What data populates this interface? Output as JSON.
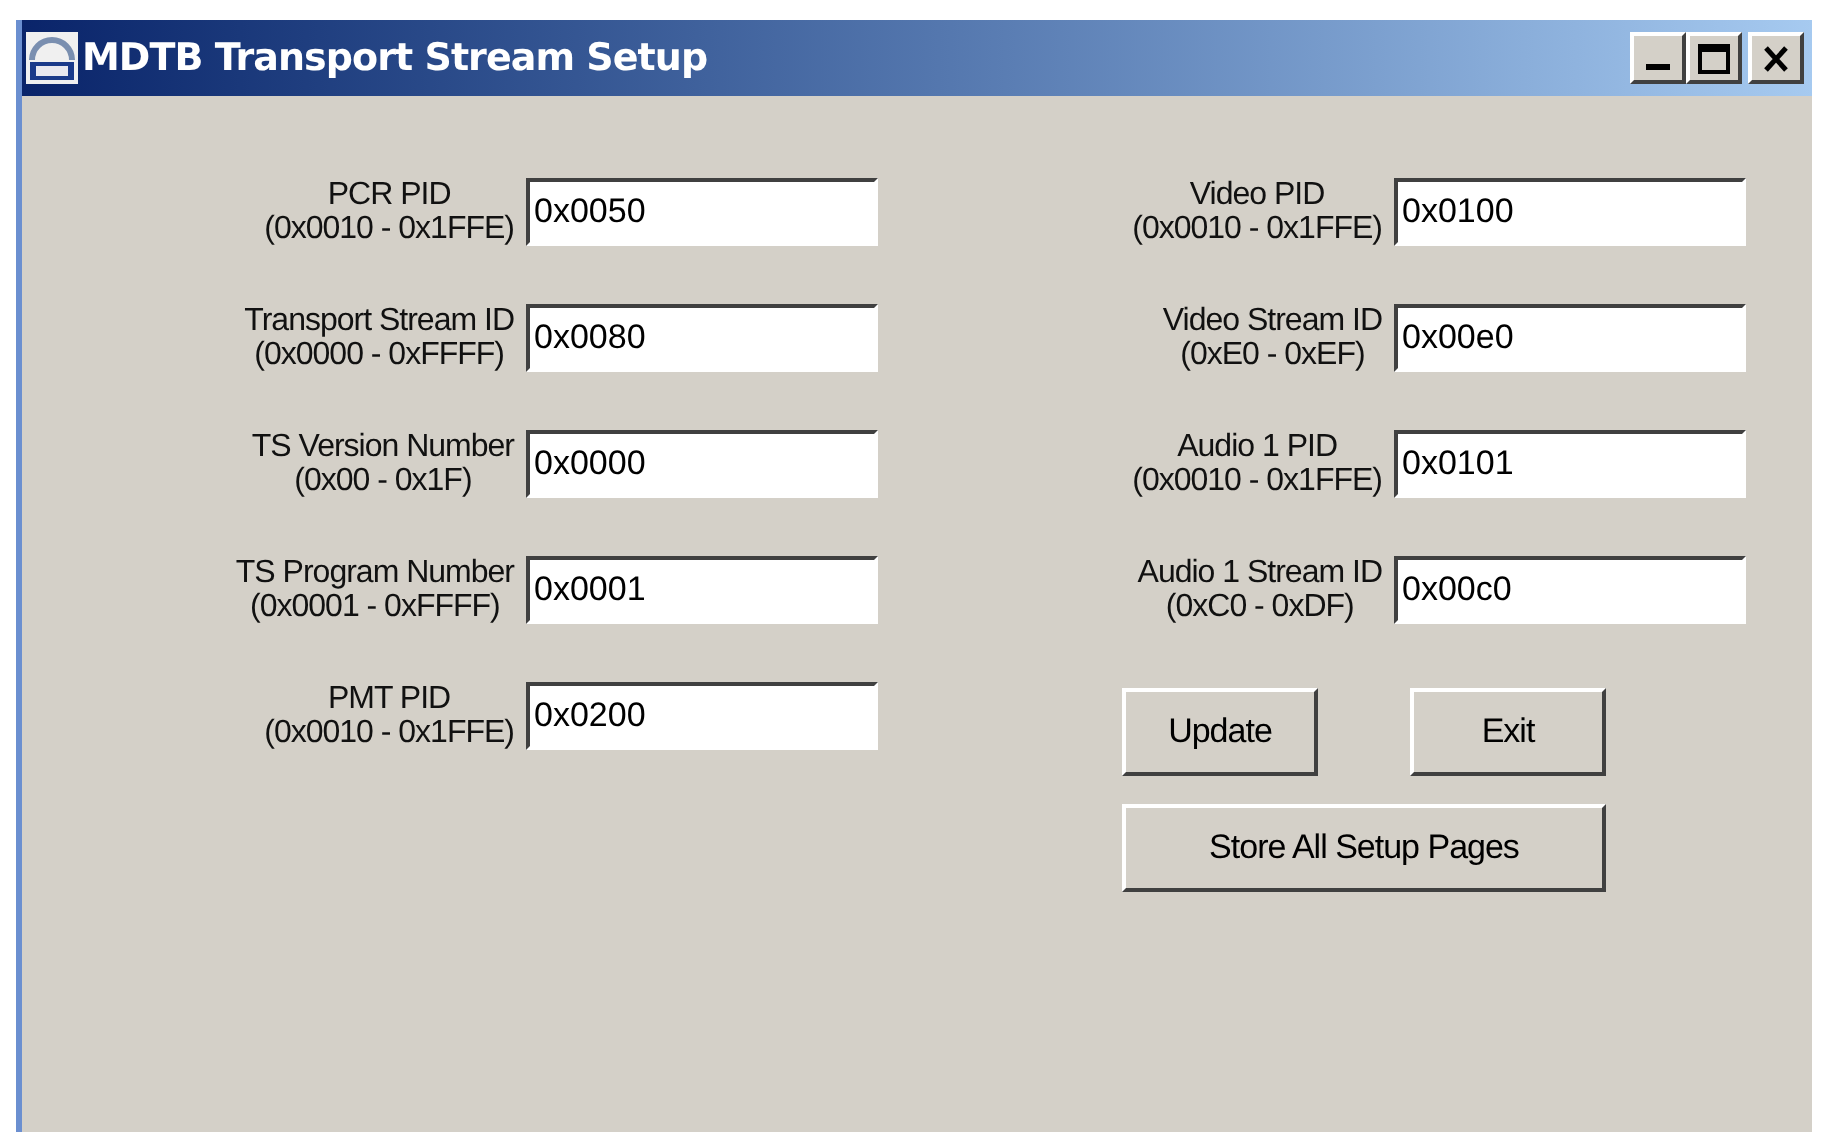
{
  "window": {
    "title": "MDTB Transport Stream Setup"
  },
  "left_fields": [
    {
      "label": "PCR PID",
      "range": "(0x0010 - 0x1FFE)",
      "value": "0x0050"
    },
    {
      "label": "Transport Stream ID",
      "range": "(0x0000 - 0xFFFF)",
      "value": "0x0080"
    },
    {
      "label": "TS Version Number",
      "range": "(0x00 - 0x1F)",
      "value": "0x0000"
    },
    {
      "label": "TS Program Number",
      "range": "(0x0001 - 0xFFFF)",
      "value": "0x0001"
    },
    {
      "label": "PMT PID",
      "range": "(0x0010 - 0x1FFE)",
      "value": "0x0200"
    }
  ],
  "right_fields": [
    {
      "label": "Video PID",
      "range": "(0x0010 - 0x1FFE)",
      "value": "0x0100"
    },
    {
      "label": "Video Stream ID",
      "range": "(0xE0 - 0xEF)",
      "value": "0x00e0"
    },
    {
      "label": "Audio 1 PID",
      "range": "(0x0010 - 0x1FFE)",
      "value": "0x0101"
    },
    {
      "label": "Audio 1 Stream ID",
      "range": "(0xC0 - 0xDF)",
      "value": "0x00c0"
    }
  ],
  "buttons": [
    "Update",
    "Exit",
    "Store All Setup Pages"
  ]
}
